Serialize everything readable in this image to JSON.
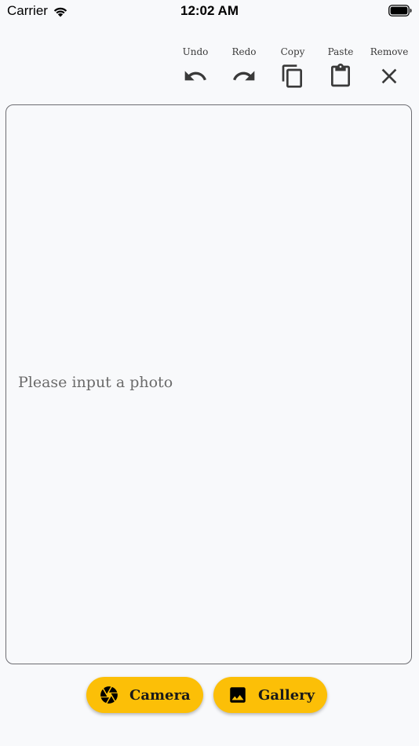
{
  "status_bar": {
    "carrier": "Carrier",
    "time": "12:02 AM"
  },
  "toolbar": {
    "items": [
      {
        "label": "Undo",
        "icon": "undo-icon"
      },
      {
        "label": "Redo",
        "icon": "redo-icon"
      },
      {
        "label": "Copy",
        "icon": "copy-icon"
      },
      {
        "label": "Paste",
        "icon": "paste-icon"
      },
      {
        "label": "Remove",
        "icon": "close-icon"
      }
    ]
  },
  "photo_area": {
    "placeholder": "Please input a photo"
  },
  "actions": {
    "camera_label": "Camera",
    "camera_icon": "camera-aperture-icon",
    "gallery_label": "Gallery",
    "gallery_icon": "image-icon"
  },
  "colors": {
    "background": "#f8f9fb",
    "accent": "#fcbf07",
    "border": "#6d6d72",
    "icon": "#3a3a3a"
  }
}
